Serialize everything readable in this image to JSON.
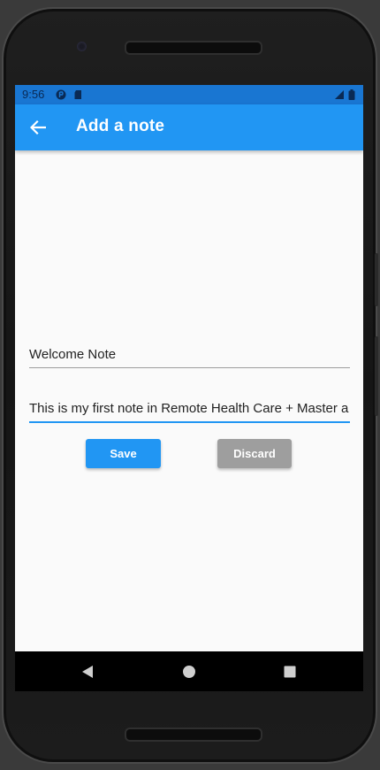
{
  "status_bar": {
    "time": "9:56",
    "icons": [
      "app-notification-icon",
      "sd-card-icon",
      "signal-icon",
      "battery-icon"
    ]
  },
  "app_bar": {
    "title": "Add a note",
    "back_icon": "arrow-back-icon",
    "color": "#2196f3"
  },
  "form": {
    "title_value": "Welcome Note",
    "body_value": "This is my first note in Remote Health Care + Master a"
  },
  "actions": {
    "save_label": "Save",
    "discard_label": "Discard",
    "save_color": "#2196f3",
    "discard_color": "#9e9e9e"
  },
  "nav": {
    "icons": [
      "back-triangle-icon",
      "home-circle-icon",
      "recents-square-icon"
    ]
  }
}
